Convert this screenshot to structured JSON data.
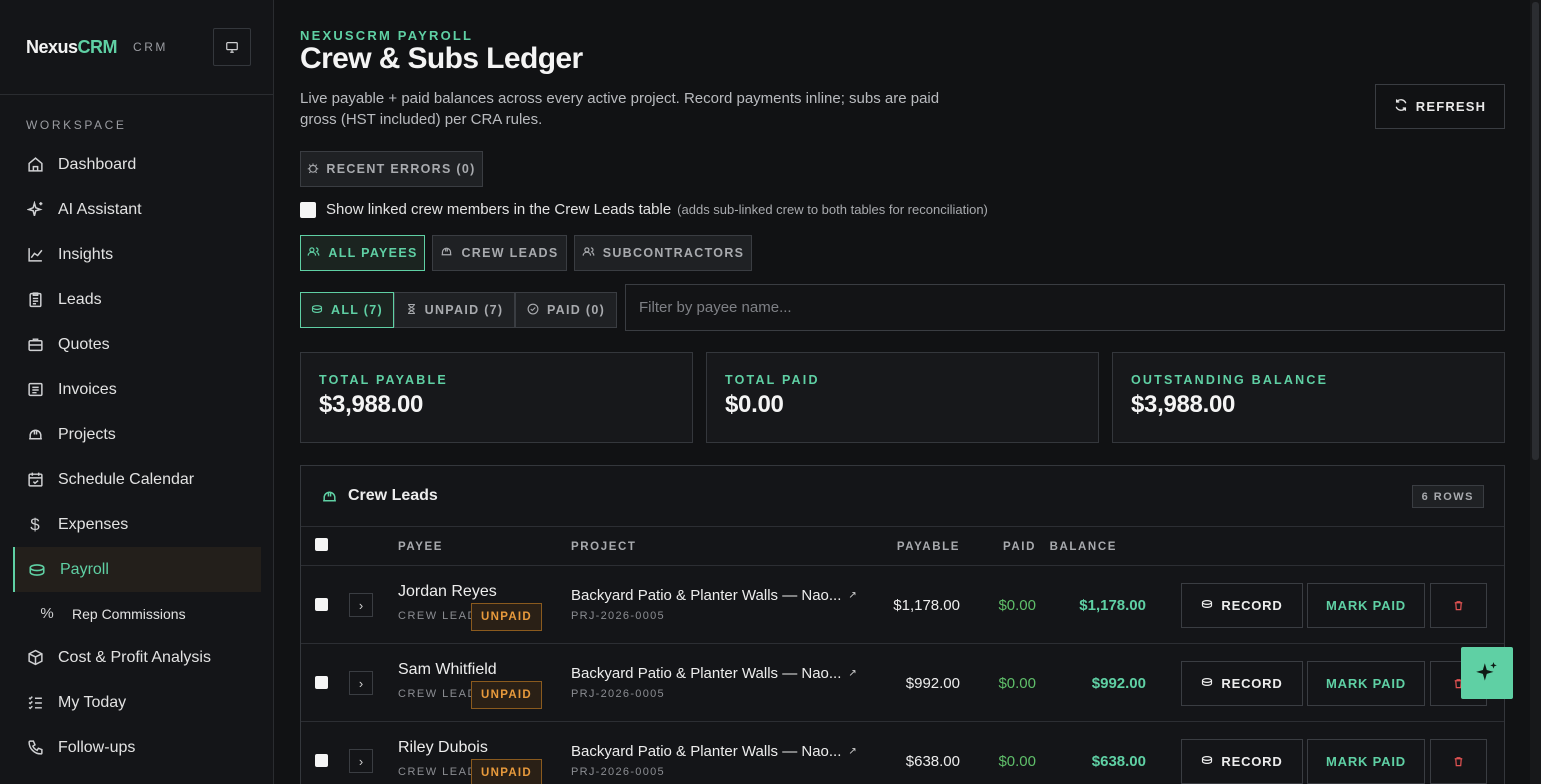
{
  "brand": {
    "name_part1": "Nexus",
    "name_part2": "CRM",
    "sub": "CRM"
  },
  "sidebar": {
    "section_label": "WORKSPACE",
    "items": [
      {
        "label": "Dashboard",
        "icon": "home-icon"
      },
      {
        "label": "AI Assistant",
        "icon": "sparkle-icon"
      },
      {
        "label": "Insights",
        "icon": "chart-icon"
      },
      {
        "label": "Leads",
        "icon": "clipboard-icon"
      },
      {
        "label": "Quotes",
        "icon": "briefcase-icon"
      },
      {
        "label": "Invoices",
        "icon": "invoice-icon"
      },
      {
        "label": "Projects",
        "icon": "hardhat-icon"
      },
      {
        "label": "Schedule Calendar",
        "icon": "calendar-icon"
      },
      {
        "label": "Expenses",
        "icon": "dollar-icon"
      },
      {
        "label": "Payroll",
        "icon": "money-icon",
        "active": true
      },
      {
        "label": "Rep Commissions",
        "icon": "percent-icon",
        "sub": true
      },
      {
        "label": "Cost & Profit Analysis",
        "icon": "box-icon"
      },
      {
        "label": "My Today",
        "icon": "checklist-icon"
      },
      {
        "label": "Follow-ups",
        "icon": "phone-icon"
      }
    ]
  },
  "header": {
    "kicker": "NEXUSCRM PAYROLL",
    "title": "Crew & Subs Ledger",
    "subtitle": "Live payable + paid balances across every active project. Record payments inline; subs are paid gross (HST included) per CRA rules.",
    "refresh_label": "REFRESH",
    "errors_label": "RECENT ERRORS (0)"
  },
  "linked_toggle": {
    "label": "Show linked crew members in the Crew Leads table",
    "hint": "(adds sub-linked crew to both tables for reconciliation)"
  },
  "payee_tabs": [
    "ALL PAYEES",
    "CREW LEADS",
    "SUBCONTRACTORS"
  ],
  "status_tabs": [
    "ALL (7)",
    "UNPAID (7)",
    "PAID (0)"
  ],
  "filter": {
    "placeholder": "Filter by payee name...",
    "value": ""
  },
  "totals": [
    {
      "label": "TOTAL PAYABLE",
      "value": "$3,988.00"
    },
    {
      "label": "TOTAL PAID",
      "value": "$0.00"
    },
    {
      "label": "OUTSTANDING BALANCE",
      "value": "$3,988.00"
    }
  ],
  "colors": {
    "accent": "#5fd0a4",
    "unpaid": "#e89a3c",
    "paid": "#5fbf6a",
    "danger": "#e05252"
  },
  "crew_table": {
    "title": "Crew Leads",
    "rows_badge": "6 ROWS",
    "columns": [
      "PAYEE",
      "PROJECT",
      "PAYABLE",
      "PAID",
      "BALANCE"
    ],
    "record_label": "RECORD",
    "mark_paid_label": "MARK PAID",
    "rows": [
      {
        "name": "Jordan Reyes",
        "role": "CREW LEAD",
        "status": "UNPAID",
        "project": "Backyard Patio & Planter Walls — Nao...",
        "project_id": "PRJ-2026-0005",
        "payable": "$1,178.00",
        "paid": "$0.00",
        "balance": "$1,178.00"
      },
      {
        "name": "Sam Whitfield",
        "role": "CREW LEAD",
        "status": "UNPAID",
        "project": "Backyard Patio & Planter Walls — Nao...",
        "project_id": "PRJ-2026-0005",
        "payable": "$992.00",
        "paid": "$0.00",
        "balance": "$992.00"
      },
      {
        "name": "Riley Dubois",
        "role": "CREW LEAD",
        "status": "UNPAID",
        "project": "Backyard Patio & Planter Walls — Nao...",
        "project_id": "PRJ-2026-0005",
        "payable": "$638.00",
        "paid": "$0.00",
        "balance": "$638.00"
      }
    ]
  }
}
